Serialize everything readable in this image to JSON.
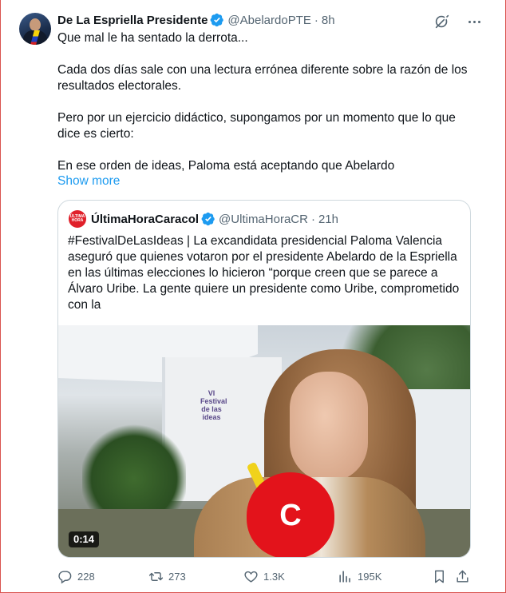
{
  "tweet": {
    "author": {
      "name": "De La Espriella Presidente",
      "handle": "@AbelardoPTE",
      "separator": "·",
      "time": "8h"
    },
    "lines": {
      "l1": "Que mal le ha sentado la derrota...",
      "l2": "Cada dos días sale con una lectura errónea diferente sobre la razón de los",
      "l3": "resultados electorales.",
      "l4": "Pero por un ejercicio didáctico, supongamos por un momento que lo que",
      "l5": "dice es cierto:",
      "l6": "En ese orden de ideas, Paloma está aceptando que Abelardo"
    },
    "show_more": "Show more"
  },
  "quote": {
    "avatar_text": "ÚLTIMA HORA",
    "author": {
      "name": "ÚltimaHoraCaracol",
      "handle": "@UltimaHoraCR",
      "separator": "·",
      "time": "21h"
    },
    "lines": {
      "l1": "#FestivalDeLasIdeas | La excandidata presidencial Paloma Valencia",
      "l2": "aseguró que quienes votaron por el presidente Abelardo de la Espriella",
      "l3": "en las últimas elecciones lo hicieron “porque creen que se parece a",
      "l4": "Álvaro Uribe. La gente quiere un presidente como Uribe, comprometido",
      "l5": "con la"
    },
    "video": {
      "duration": "0:14",
      "booth_label": "VI Festival de las ideas",
      "mic_logo": "C"
    }
  },
  "actions": {
    "replies": "228",
    "reposts": "273",
    "likes": "1.3K",
    "views": "195K"
  },
  "colors": {
    "accent": "#1d9bf0",
    "text": "#0f1419",
    "muted": "#536471",
    "border": "#cfd9de"
  }
}
